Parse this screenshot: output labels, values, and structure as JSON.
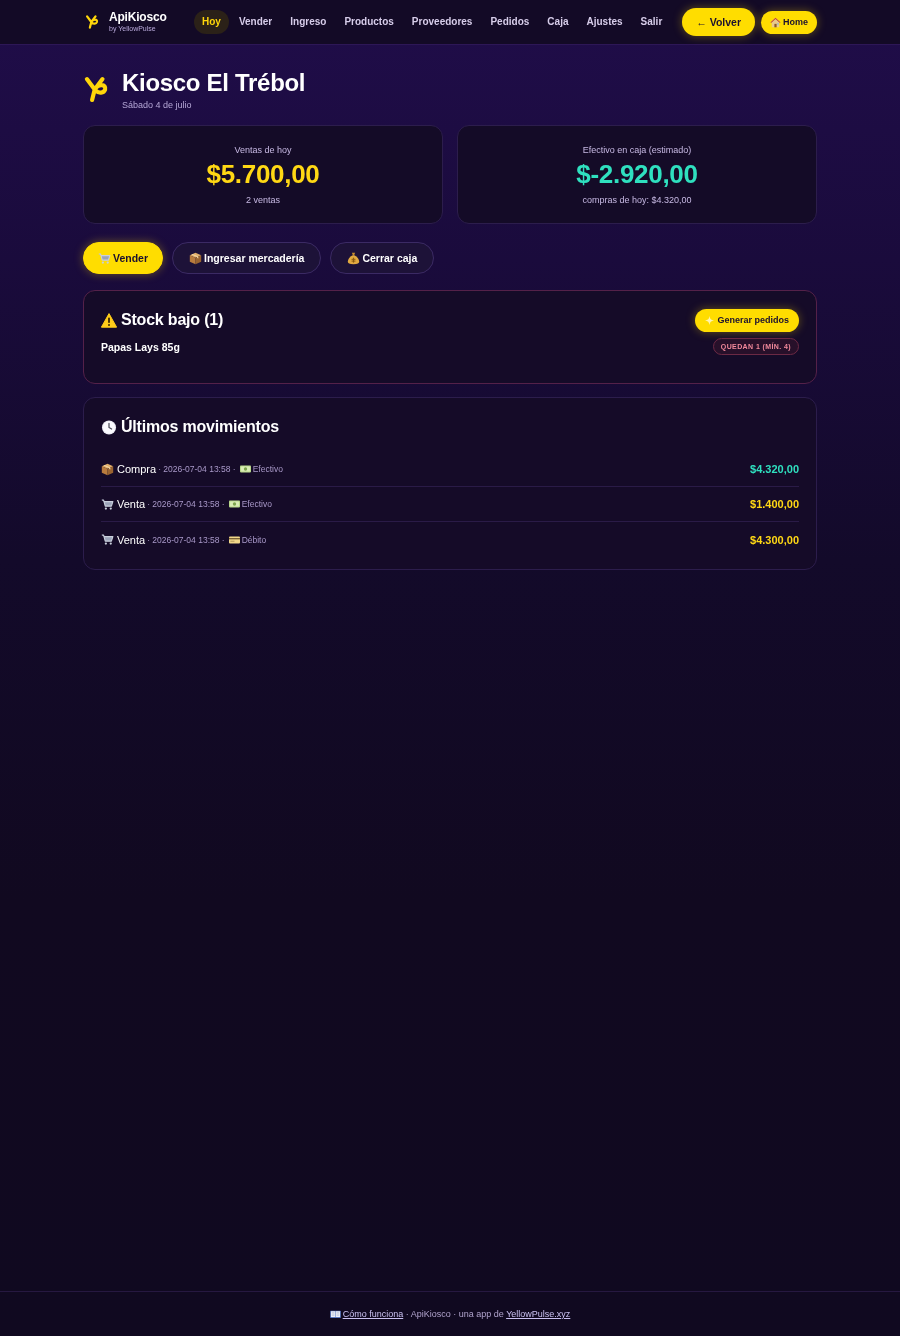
{
  "header": {
    "brand": {
      "name": "ApiKiosco",
      "tagline": "by YellowPulse"
    },
    "nav": [
      {
        "label": "Hoy",
        "selected": true
      },
      {
        "label": "Vender",
        "selected": false
      },
      {
        "label": "Ingreso",
        "selected": false
      },
      {
        "label": "Productos",
        "selected": false
      },
      {
        "label": "Proveedores",
        "selected": false
      },
      {
        "label": "Pedidos",
        "selected": false
      },
      {
        "label": "Caja",
        "selected": false
      },
      {
        "label": "Ajustes",
        "selected": false
      },
      {
        "label": "Salir",
        "selected": false
      }
    ],
    "back_button": "← Volver",
    "home_button": "Home"
  },
  "page": {
    "title": "Kiosco El Trébol",
    "date": "Sábado 4 de julio"
  },
  "stats": [
    {
      "kind": "sales",
      "label": "Ventas de hoy",
      "value": "$5.700,00",
      "note": "2 ventas"
    },
    {
      "kind": "cash",
      "label": "Efectivo en caja (estimado)",
      "value": "$-2.920,00",
      "note": "compras de hoy: $4.320,00"
    }
  ],
  "actions": [
    {
      "kind": "sell",
      "label": "Vender",
      "primary": true
    },
    {
      "kind": "receive",
      "label": "Ingresar mercadería",
      "primary": false
    },
    {
      "kind": "close",
      "label": "Cerrar caja",
      "primary": false
    }
  ],
  "low_stock": {
    "title": "Stock bajo (1)",
    "button": "Generar pedidos",
    "items": [
      {
        "name": "Papas Lays 85g",
        "badge": "QUEDAN 1 (MÍN. 4)"
      }
    ]
  },
  "movements": {
    "title": "Últimos movimientos",
    "rows": [
      {
        "kind": "purchase",
        "type": "Compra",
        "meta": "· 2026-07-04 13:58 ·",
        "method": {
          "kind": "cash",
          "label": "Efectivo"
        },
        "amount": "$4.320,00"
      },
      {
        "kind": "sale",
        "type": "Venta",
        "meta": "· 2026-07-04 13:58 ·",
        "method": {
          "kind": "cash",
          "label": "Efectivo"
        },
        "amount": "$1.400,00"
      },
      {
        "kind": "sale",
        "type": "Venta",
        "meta": "· 2026-07-04 13:58 ·",
        "method": {
          "kind": "debit",
          "label": "Débito"
        },
        "amount": "$4.300,00"
      }
    ]
  },
  "footer": {
    "help_link": "Cómo funciona",
    "text": "· ApiKiosco · una app de",
    "site_link": "YellowPulse.xyz"
  }
}
